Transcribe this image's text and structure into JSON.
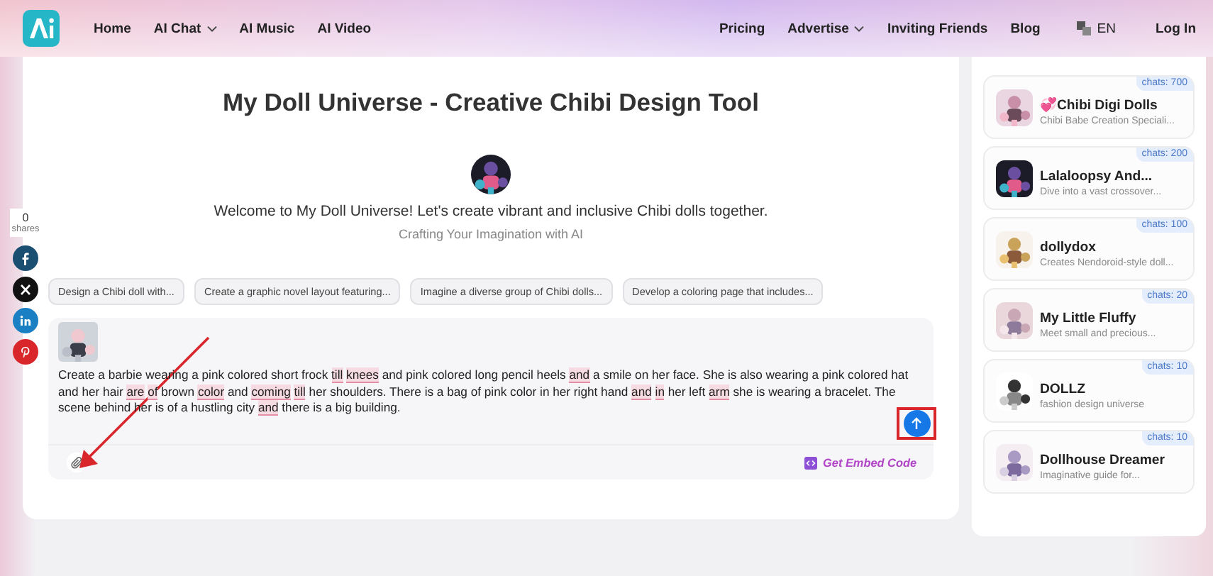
{
  "header": {
    "nav_left": [
      {
        "label": "Home",
        "dropdown": false
      },
      {
        "label": "AI Chat",
        "dropdown": true
      },
      {
        "label": "AI Music",
        "dropdown": false
      },
      {
        "label": "AI Video",
        "dropdown": false
      }
    ],
    "nav_right": [
      {
        "label": "Pricing",
        "dropdown": false
      },
      {
        "label": "Advertise",
        "dropdown": true
      },
      {
        "label": "Inviting Friends",
        "dropdown": false
      },
      {
        "label": "Blog",
        "dropdown": false
      }
    ],
    "language": "EN",
    "login": "Log In"
  },
  "share": {
    "count": "0",
    "label": "shares",
    "networks": [
      {
        "kind": "facebook",
        "color": "#1b4f72"
      },
      {
        "kind": "x",
        "color": "#111111"
      },
      {
        "kind": "linkedin",
        "color": "#1b7fc4"
      },
      {
        "kind": "pinterest",
        "color": "#d9262b"
      }
    ]
  },
  "tool": {
    "title": "My Doll Universe - Creative Chibi Design Tool",
    "welcome": "Welcome to My Doll Universe! Let's create vibrant and inclusive Chibi dolls together.",
    "tagline": "Crafting Your Imagination with AI",
    "suggestions": [
      "Design a Chibi doll with...",
      "Create a graphic novel layout featuring...",
      "Imagine a diverse group of Chibi dolls...",
      "Develop a coloring page that includes..."
    ],
    "prompt": {
      "segments": [
        {
          "text": "Create a barbie wearing a pink colored short frock ",
          "flagged": false
        },
        {
          "text": "till knees",
          "flagged": true
        },
        {
          "text": " and pink colored long pencil heels ",
          "flagged": false
        },
        {
          "text": "and",
          "flagged": true
        },
        {
          "text": " a smile on her face. She is also wearing a pink colored hat and her hair ",
          "flagged": false
        },
        {
          "text": "are of",
          "flagged": true
        },
        {
          "text": " brown ",
          "flagged": false
        },
        {
          "text": "color",
          "flagged": true
        },
        {
          "text": " and ",
          "flagged": false
        },
        {
          "text": "coming till",
          "flagged": true
        },
        {
          "text": " her shoulders. There is a bag of pink color in her right hand ",
          "flagged": false
        },
        {
          "text": "and in",
          "flagged": true
        },
        {
          "text": " her left ",
          "flagged": false
        },
        {
          "text": "arm",
          "flagged": true
        },
        {
          "text": " she is wearing a bracelet. The scene behind her is of a hustling city ",
          "flagged": false
        },
        {
          "text": "and",
          "flagged": true
        },
        {
          "text": " there is a big building.",
          "flagged": false
        }
      ]
    },
    "embed": "Get Embed Code"
  },
  "related_tools": [
    {
      "name": "💞Chibi Digi Dolls",
      "description": "Chibi Babe Creation Speciali...",
      "chats": "chats: 700"
    },
    {
      "name": "Lalaloopsy And...",
      "description": "Dive into a vast crossover...",
      "chats": "chats: 200"
    },
    {
      "name": "dollydox",
      "description": "Creates Nendoroid-style doll...",
      "chats": "chats: 100"
    },
    {
      "name": "My Little Fluffy",
      "description": "Meet small and precious...",
      "chats": "chats: 20"
    },
    {
      "name": "DOLLZ",
      "description": "fashion design universe",
      "chats": "chats: 10"
    },
    {
      "name": "Dollhouse Dreamer",
      "description": "Imaginative guide for...",
      "chats": "chats: 10"
    }
  ]
}
